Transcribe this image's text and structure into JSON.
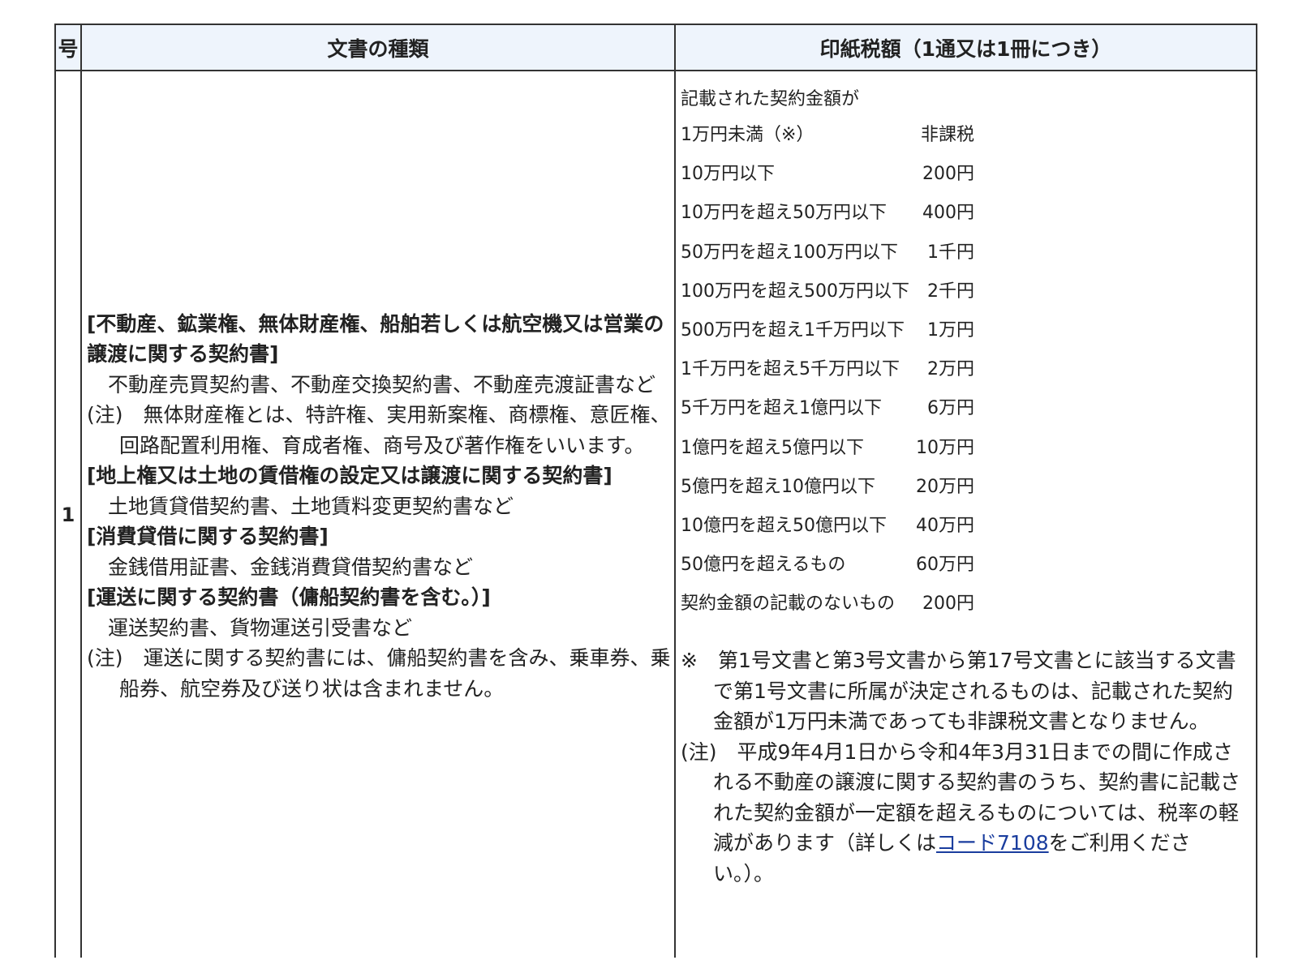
{
  "header": {
    "col_no": "号",
    "col_doc": "文書の種類",
    "col_tax": "印紙税額（1通又は1冊につき）"
  },
  "row": {
    "number": "1",
    "doc_lines": [
      {
        "style": "b",
        "text": "[不動産、鉱業権、無体財産権、船舶若しくは航空機又は営業の譲渡に関する契約書]"
      },
      {
        "style": "ind",
        "text": "不動産売買契約書、不動産交換契約書、不動産売渡証書など"
      },
      {
        "style": "note",
        "text": "(注)　無体財産権とは、特許権、実用新案権、商標権、意匠権、回路配置利用権、育成者権、商号及び著作権をいいます。"
      },
      {
        "style": "b",
        "text": "[地上権又は土地の賃借権の設定又は譲渡に関する契約書]"
      },
      {
        "style": "ind",
        "text": "土地賃貸借契約書、土地賃料変更契約書など"
      },
      {
        "style": "b",
        "text": "[消費貸借に関する契約書]"
      },
      {
        "style": "ind",
        "text": "金銭借用証書、金銭消費貸借契約書など"
      },
      {
        "style": "b",
        "text": "[運送に関する契約書（傭船契約書を含む。）]"
      },
      {
        "style": "ind",
        "text": "運送契約書、貨物運送引受書など"
      },
      {
        "style": "note2",
        "text": "(注)　運送に関する契約書には、傭船契約書を含み、乗車券、乗船券、航空券及び送り状は含まれません。"
      }
    ],
    "tax_lead": "記載された契約金額が",
    "rates": [
      {
        "label": "1万円未満（※）",
        "value": "非課税"
      },
      {
        "label": "10万円以下",
        "value": "200円"
      },
      {
        "label": "10万円を超え50万円以下",
        "value": "400円"
      },
      {
        "label": "50万円を超え100万円以下",
        "value": "1千円"
      },
      {
        "label": "100万円を超え500万円以下",
        "value": "2千円"
      },
      {
        "label": "500万円を超え1千万円以下",
        "value": "1万円"
      },
      {
        "label": "1千万円を超え5千万円以下",
        "value": "2万円"
      },
      {
        "label": "5千万円を超え1億円以下",
        "value": "6万円"
      },
      {
        "label": "1億円を超え5億円以下",
        "value": "10万円"
      },
      {
        "label": "5億円を超え10億円以下",
        "value": "20万円"
      },
      {
        "label": "10億円を超え50億円以下",
        "value": "40万円"
      },
      {
        "label": "50億円を超えるもの",
        "value": "60万円"
      },
      {
        "label": "契約金額の記載のないもの",
        "value": "200円"
      }
    ],
    "footnote_asterisk": "※　第1号文書と第3号文書から第17号文書とに該当する文書で第1号文書に所属が決定されるものは、記載された契約金額が1万円未満であっても非課税文書となりません。",
    "footnote_note_pre": "(注)　平成9年4月1日から令和4年3月31日までの間に作成される不動産の譲渡に関する契約書のうち、契約書に記載された契約金額が一定額を超えるものについては、税率の軽減があります（詳しくは",
    "footnote_link": "コード7108",
    "footnote_note_post": "をご利用ください。）。"
  }
}
